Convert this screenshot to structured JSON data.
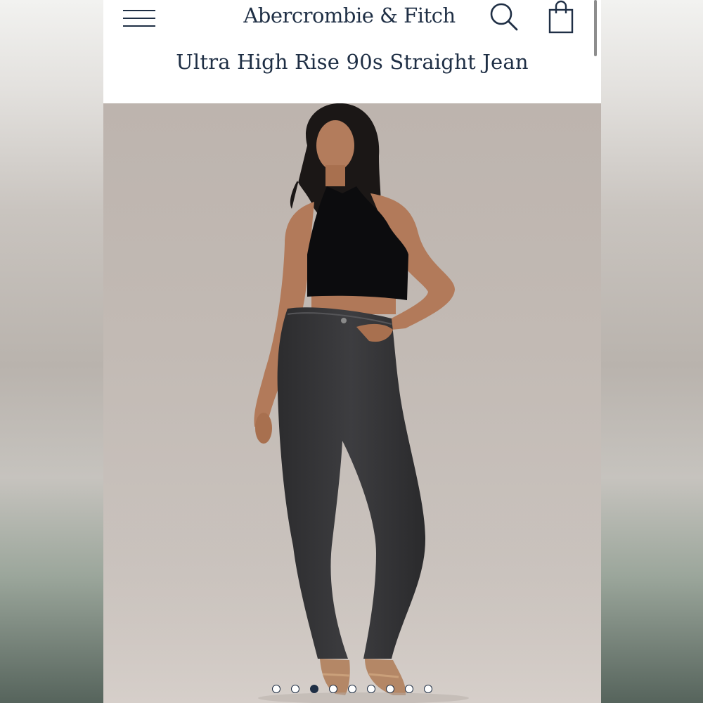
{
  "header": {
    "brand": "Abercrombie & Fitch",
    "menu_icon": "hamburger-menu-icon",
    "search_icon": "search-icon",
    "bag_icon": "shopping-bag-icon"
  },
  "product": {
    "title": "Ultra High Rise 90s Straight Jean"
  },
  "gallery": {
    "image_count": 9,
    "active_index": 2
  },
  "colors": {
    "brand_navy": "#1f2f45",
    "photo_bg": "#c2bab4"
  }
}
